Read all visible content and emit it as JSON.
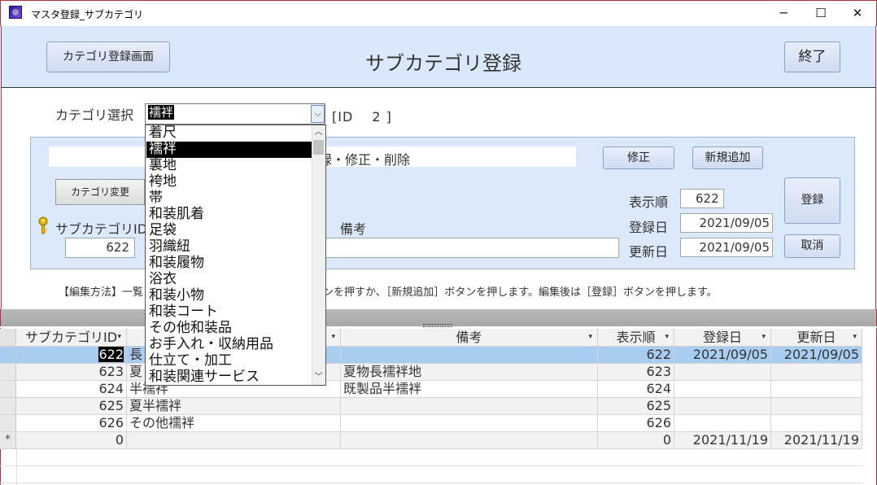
{
  "window": {
    "title": "マスタ登録_サブカテゴリ",
    "minimize_glyph": "─",
    "maximize_glyph": "☐",
    "close_glyph": "✕",
    "icon": "app-icon"
  },
  "header": {
    "category_screen_button": "カテゴリ登録画面",
    "heading": "サブカテゴリ登録",
    "exit_button": "終了"
  },
  "category_select": {
    "label": "カテゴリ選択",
    "value": "襦袢",
    "id_display": "[ID　 2 ]",
    "arrow_glyph": "⌵"
  },
  "dropdown": {
    "items": [
      "着尺",
      "襦袢",
      "裏地",
      "袴地",
      "帯",
      "和装肌着",
      "足袋",
      "羽織紐",
      "和装履物",
      "浴衣",
      "和装小物",
      "和装コート",
      "その他和装品",
      "お手入れ・収納用品",
      "仕立て・加工",
      "和装関連サービス"
    ],
    "selected_index": 1,
    "scroll_up_glyph": "︿",
    "scroll_down_glyph": "﹀"
  },
  "edit_panel": {
    "banner_text": "録・修正・削除",
    "modify_button": "修正",
    "new_button": "新規追加",
    "change_category_button": "カテゴリ変更",
    "subcategory_id_label": "サブカテゴリID",
    "subcategory_id_value": "622",
    "remarks_label": "備考",
    "remarks_value": "",
    "display_order_label": "表示順",
    "display_order_value": "622",
    "created_label": "登録日",
    "created_value": "2021/09/05",
    "updated_label": "更新日",
    "updated_value": "2021/09/05",
    "register_button": "登録",
    "cancel_button": "取消",
    "key_icon": "key-icon"
  },
  "instructions": "【編集方法】一覧　　　　　　　　　　　　　　　ボタンを押すか、［新規追加］ボタンを押します。編集後は［登録］ボタンを押します。",
  "grid": {
    "columns": [
      "サブカテゴリID",
      "",
      "備考",
      "表示順",
      "登録日",
      "更新日"
    ],
    "sort_glyph": "▾",
    "new_row_marker": "*",
    "rows": [
      {
        "id": "622",
        "name": "長",
        "remarks": "",
        "order": "622",
        "created": "2021/09/05",
        "updated": "2021/09/05"
      },
      {
        "id": "623",
        "name": "夏",
        "remarks": "夏物長襦袢地",
        "order": "623",
        "created": "",
        "updated": ""
      },
      {
        "id": "624",
        "name": "半襦袢",
        "remarks": "既製品半襦袢",
        "order": "624",
        "created": "",
        "updated": ""
      },
      {
        "id": "625",
        "name": "夏半襦袢",
        "remarks": "",
        "order": "625",
        "created": "",
        "updated": ""
      },
      {
        "id": "626",
        "name": "その他襦袢",
        "remarks": "",
        "order": "626",
        "created": "",
        "updated": ""
      },
      {
        "id": "0",
        "name": "",
        "remarks": "",
        "order": "0",
        "created": "2021/11/19",
        "updated": "2021/11/19"
      }
    ]
  }
}
